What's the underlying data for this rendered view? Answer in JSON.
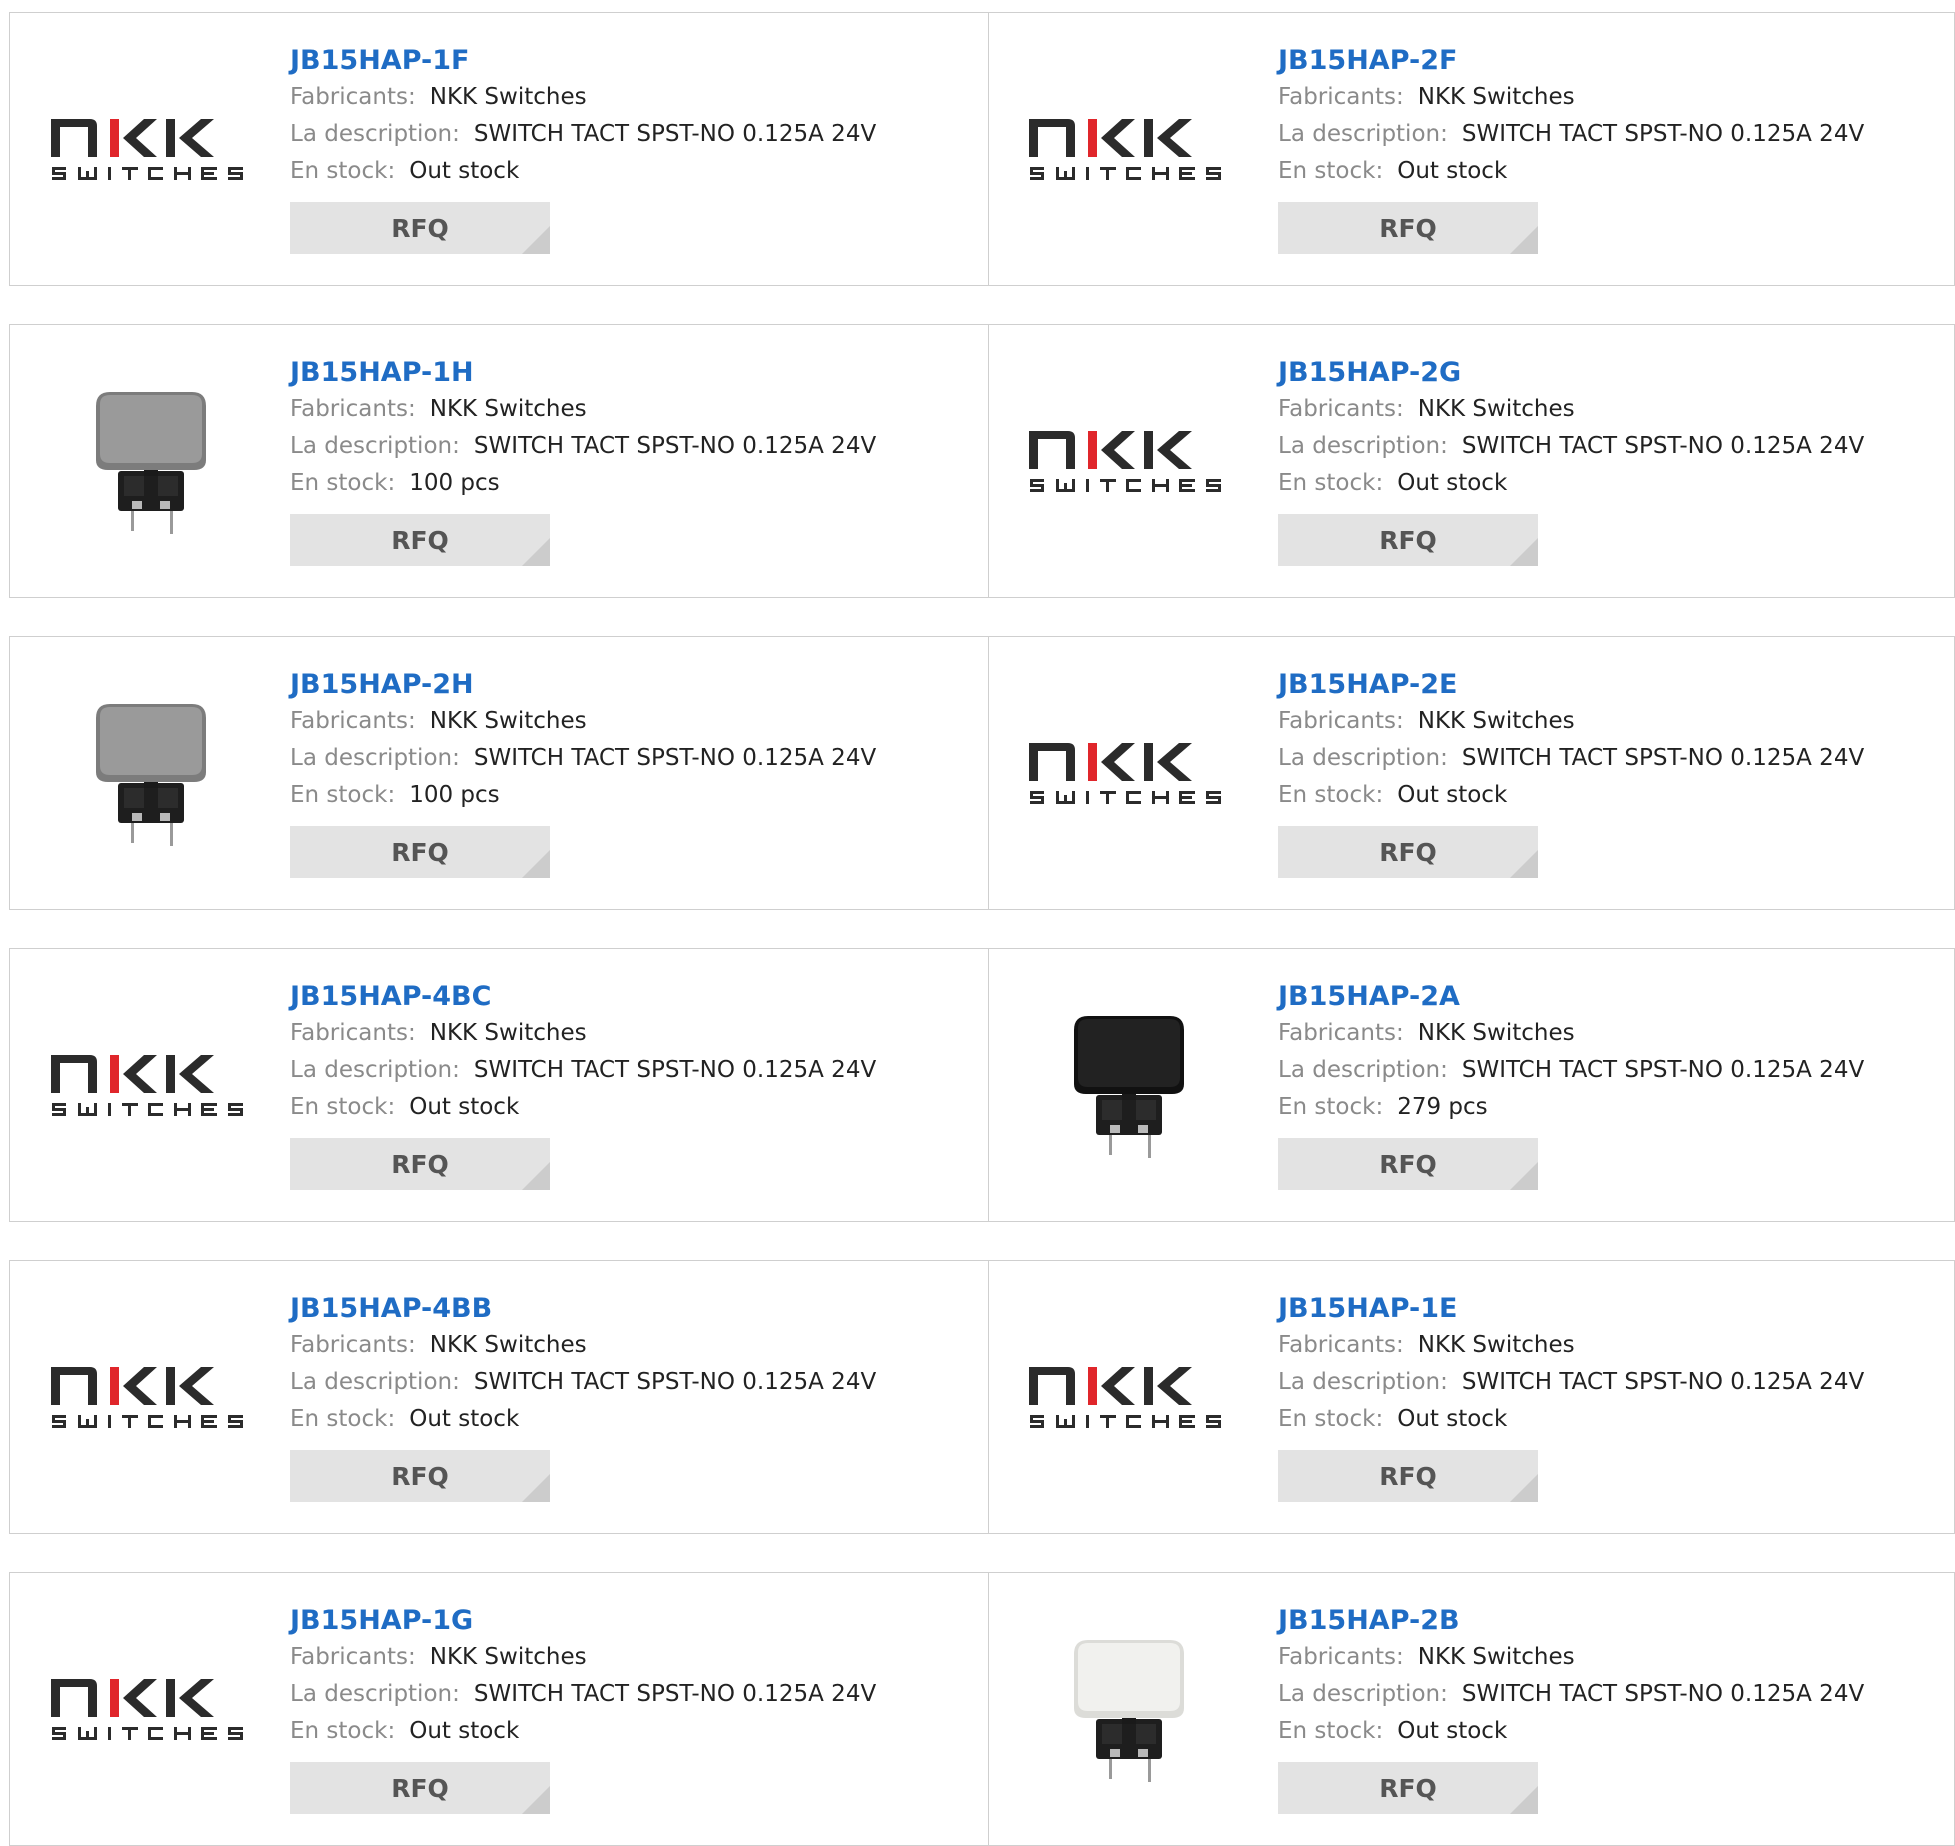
{
  "labels": {
    "manufacturer": "Fabricants:",
    "description": "La description:",
    "stock": "En stock:",
    "rfq": "RFQ"
  },
  "logo": {
    "brand_top": "NKK",
    "brand_bottom": "SWITCHES"
  },
  "products": [
    {
      "name": "JB15HAP-1F",
      "manufacturer": "NKK Switches",
      "description": "SWITCH TACT SPST-NO 0.125A 24V",
      "stock": "Out stock",
      "image": "nkk-logo"
    },
    {
      "name": "JB15HAP-2F",
      "manufacturer": "NKK Switches",
      "description": "SWITCH TACT SPST-NO 0.125A 24V",
      "stock": "Out stock",
      "image": "nkk-logo"
    },
    {
      "name": "JB15HAP-1H",
      "manufacturer": "NKK Switches",
      "description": "SWITCH TACT SPST-NO 0.125A 24V",
      "stock": "100 pcs",
      "image": "gray-switch"
    },
    {
      "name": "JB15HAP-2G",
      "manufacturer": "NKK Switches",
      "description": "SWITCH TACT SPST-NO 0.125A 24V",
      "stock": "Out stock",
      "image": "nkk-logo"
    },
    {
      "name": "JB15HAP-2H",
      "manufacturer": "NKK Switches",
      "description": "SWITCH TACT SPST-NO 0.125A 24V",
      "stock": "100 pcs",
      "image": "gray-switch"
    },
    {
      "name": "JB15HAP-2E",
      "manufacturer": "NKK Switches",
      "description": "SWITCH TACT SPST-NO 0.125A 24V",
      "stock": "Out stock",
      "image": "nkk-logo"
    },
    {
      "name": "JB15HAP-4BC",
      "manufacturer": "NKK Switches",
      "description": "SWITCH TACT SPST-NO 0.125A 24V",
      "stock": "Out stock",
      "image": "nkk-logo"
    },
    {
      "name": "JB15HAP-2A",
      "manufacturer": "NKK Switches",
      "description": "SWITCH TACT SPST-NO 0.125A 24V",
      "stock": "279 pcs",
      "image": "black-switch"
    },
    {
      "name": "JB15HAP-4BB",
      "manufacturer": "NKK Switches",
      "description": "SWITCH TACT SPST-NO 0.125A 24V",
      "stock": "Out stock",
      "image": "nkk-logo"
    },
    {
      "name": "JB15HAP-1E",
      "manufacturer": "NKK Switches",
      "description": "SWITCH TACT SPST-NO 0.125A 24V",
      "stock": "Out stock",
      "image": "nkk-logo"
    },
    {
      "name": "JB15HAP-1G",
      "manufacturer": "NKK Switches",
      "description": "SWITCH TACT SPST-NO 0.125A 24V",
      "stock": "Out stock",
      "image": "nkk-logo"
    },
    {
      "name": "JB15HAP-2B",
      "manufacturer": "NKK Switches",
      "description": "SWITCH TACT SPST-NO 0.125A 24V",
      "stock": "Out stock",
      "image": "white-switch"
    }
  ],
  "colors": {
    "link": "#1f6cc4",
    "logo_dark": "#2b2b2b",
    "logo_red": "#e0262b",
    "border": "#cfcfcf",
    "rfq_bg": "#e3e3e3"
  }
}
